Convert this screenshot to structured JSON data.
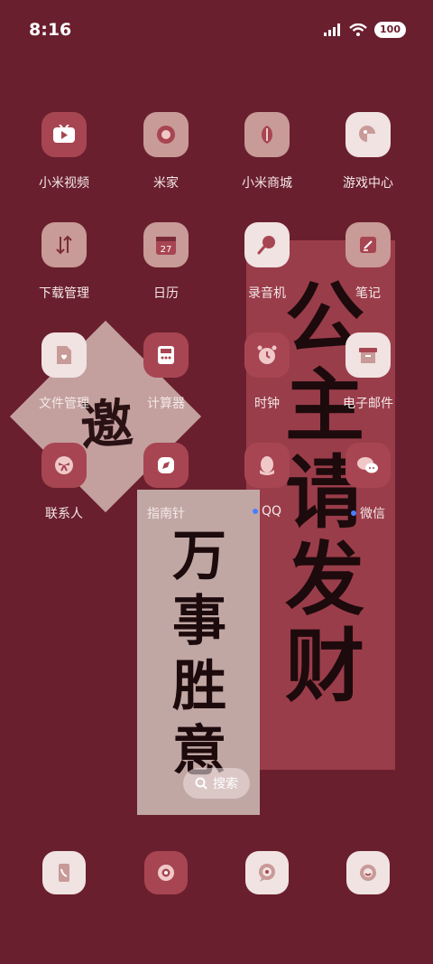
{
  "status_bar": {
    "time": "8:16",
    "battery": "100"
  },
  "apps": [
    {
      "label": "小米视频",
      "icon": "tv-icon"
    },
    {
      "label": "米家",
      "icon": "mijia-icon"
    },
    {
      "label": "小米商城",
      "icon": "store-icon"
    },
    {
      "label": "游戏中心",
      "icon": "game-center-icon"
    },
    {
      "label": "下载管理",
      "icon": "download-arrows-icon"
    },
    {
      "label": "日历",
      "icon": "calendar-icon",
      "calendar_day": "27"
    },
    {
      "label": "录音机",
      "icon": "microphone-icon"
    },
    {
      "label": "笔记",
      "icon": "notes-icon"
    },
    {
      "label": "文件管理",
      "icon": "file-icon"
    },
    {
      "label": "计算器",
      "icon": "calculator-icon"
    },
    {
      "label": "时钟",
      "icon": "alarm-clock-icon"
    },
    {
      "label": "电子邮件",
      "icon": "mail-box-icon"
    },
    {
      "label": "联系人",
      "icon": "contacts-bow-icon"
    },
    {
      "label": "指南针",
      "icon": "compass-icon"
    },
    {
      "label": "QQ",
      "icon": "qq-penguin-icon",
      "notification_dot": true
    },
    {
      "label": "微信",
      "icon": "wechat-icon",
      "notification_dot": true
    }
  ],
  "wallpaper": {
    "diamond_text": "邀",
    "right_scroll_text": "公主请发财",
    "left_scroll_text": "万事胜意"
  },
  "search": {
    "label": "搜索"
  },
  "dock": [
    {
      "icon": "phone-icon"
    },
    {
      "icon": "camera-icon"
    },
    {
      "icon": "message-icon"
    },
    {
      "icon": "browser-icon"
    }
  ],
  "colors": {
    "background": "#6a1f2e",
    "accent_dark": "#a84552",
    "accent_light": "#f0e3e2"
  }
}
